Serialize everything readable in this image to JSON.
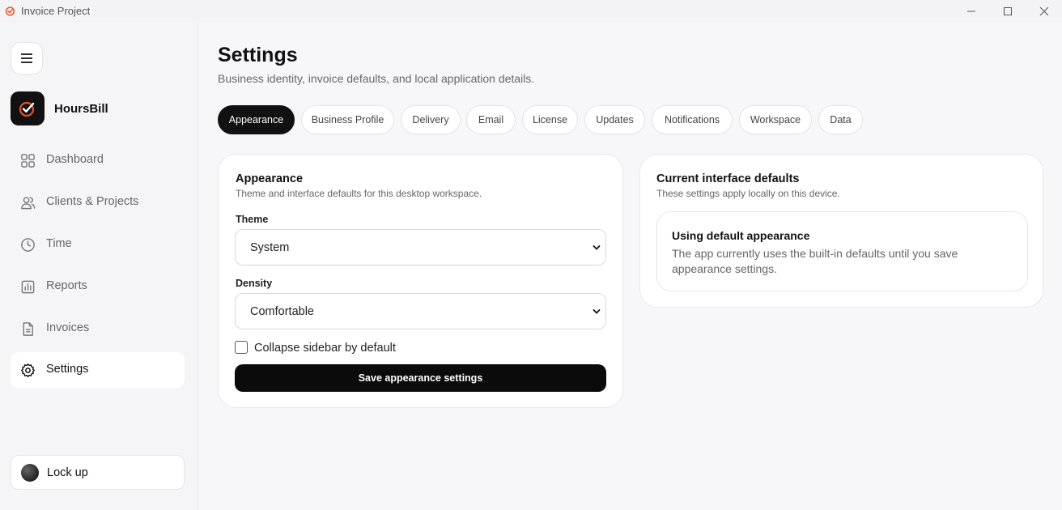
{
  "window": {
    "title": "Invoice Project"
  },
  "sidebar": {
    "brand": "HoursBill",
    "items": [
      {
        "label": "Dashboard",
        "icon": "grid-icon"
      },
      {
        "label": "Clients & Projects",
        "icon": "users-icon"
      },
      {
        "label": "Time",
        "icon": "clock-icon"
      },
      {
        "label": "Reports",
        "icon": "bar-chart-icon"
      },
      {
        "label": "Invoices",
        "icon": "document-icon"
      },
      {
        "label": "Settings",
        "icon": "gear-icon",
        "active": true
      }
    ],
    "lock_label": "Lock up"
  },
  "page": {
    "title": "Settings",
    "subtitle": "Business identity, invoice defaults, and local application details.",
    "tabs": [
      {
        "label": "Appearance",
        "active": true
      },
      {
        "label": "Business Profile"
      },
      {
        "label": "Delivery"
      },
      {
        "label": "Email"
      },
      {
        "label": "License"
      },
      {
        "label": "Updates"
      },
      {
        "label": "Notifications"
      },
      {
        "label": "Workspace"
      },
      {
        "label": "Data"
      }
    ]
  },
  "appearance": {
    "title": "Appearance",
    "subtitle": "Theme and interface defaults for this desktop workspace.",
    "theme_label": "Theme",
    "theme_value": "System",
    "density_label": "Density",
    "density_value": "Comfortable",
    "collapse_label": "Collapse sidebar by default",
    "collapse_checked": false,
    "save_label": "Save appearance settings"
  },
  "defaults": {
    "title": "Current interface defaults",
    "subtitle": "These settings apply locally on this device.",
    "box_title": "Using default appearance",
    "box_text": "The app currently uses the built-in defaults until you save appearance settings."
  },
  "colors": {
    "accent": "#111111",
    "logo_accent": "#e8542a"
  }
}
